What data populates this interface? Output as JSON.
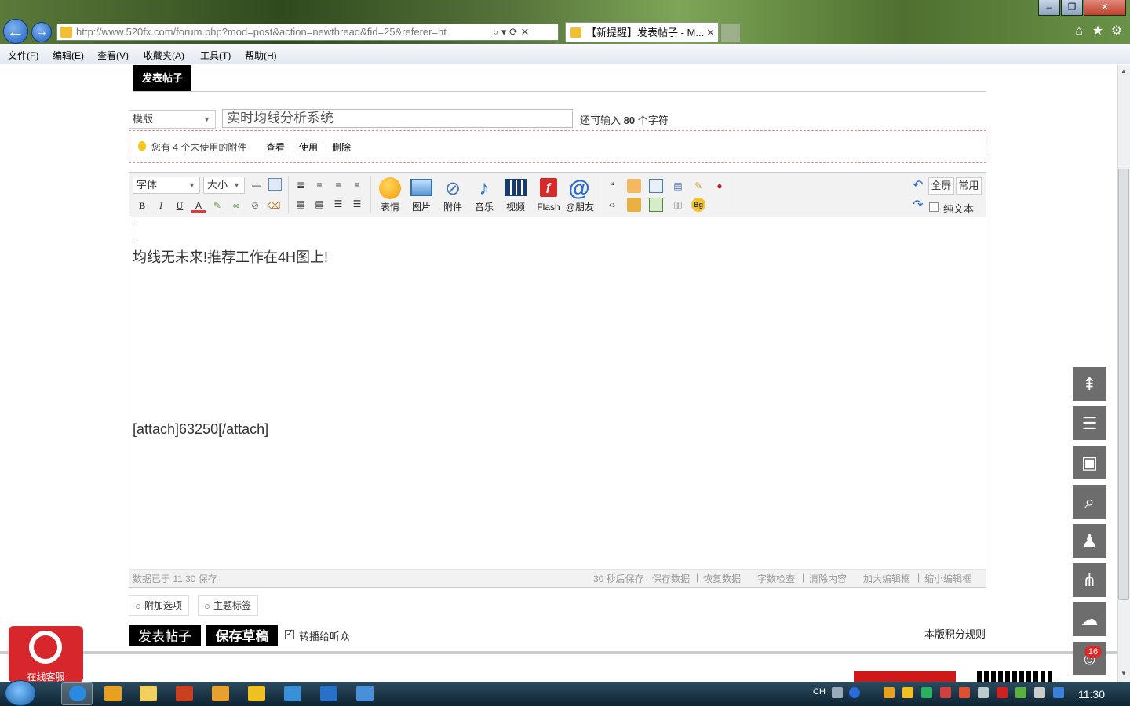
{
  "browser": {
    "address_url": "http://www.520fx.com/forum.php?mod=post&action=newthread&fid=25&referer=ht",
    "address_domain_part": "520fx.com",
    "tab_title": "【新提醒】发表帖子 - M...",
    "minimize": "–",
    "restore": "❐",
    "close": "✕",
    "nav_back": "←",
    "nav_forward": "→",
    "addr_tools": "⌕ ▾ ⟳ ✕",
    "home": "⌂",
    "favorites": "★",
    "tools": "⚙"
  },
  "menu": [
    "文件(F)",
    "编辑(E)",
    "查看(V)",
    "收藏夹(A)",
    "工具(T)",
    "帮助(H)"
  ],
  "post": {
    "tab_label": "发表帖子",
    "template_select": "模版",
    "subject_value": "实时均线分析系统",
    "char_remaining_prefix": "还可输入",
    "char_remaining_count": "80",
    "char_remaining_suffix": "个字符",
    "attach_notice": {
      "text": "您有 4 个未使用的附件",
      "view": "查看",
      "use": "使用",
      "delete": "删除"
    }
  },
  "toolbar": {
    "font_select": "字体",
    "size_select": "大小",
    "emoticon": "表情",
    "image": "图片",
    "attachment": "附件",
    "music": "音乐",
    "video": "视频",
    "flash": "Flash",
    "at_friend": "@朋友",
    "fullscreen": "全屏",
    "common": "常用",
    "plain_text": "纯文本",
    "bold": "B",
    "italic": "I",
    "underline": "U"
  },
  "editor": {
    "line1": "均线无未来!推荐工作在4H图上!",
    "line2": "[attach]63250[/attach]"
  },
  "statusbar": {
    "saved_at": "数据已于 11:30 保存",
    "autosave": "30 秒后保存",
    "save_data": "保存数据",
    "restore_data": "恢复数据",
    "word_check": "字数检查",
    "clear_content": "清除内容",
    "enlarge": "加大编辑框",
    "shrink": "缩小编辑框",
    "sep": "|"
  },
  "options": {
    "extra": "附加选项",
    "topic_tags": "主题标签",
    "submit": "发表帖子",
    "save_draft": "保存草稿",
    "broadcast": "转播给听众",
    "broadcast_checked": true,
    "rules": "本版积分规则"
  },
  "customer_service": "在线客服",
  "side_badge": "16",
  "taskbar": {
    "clock": "11:30",
    "lang": "CH"
  }
}
